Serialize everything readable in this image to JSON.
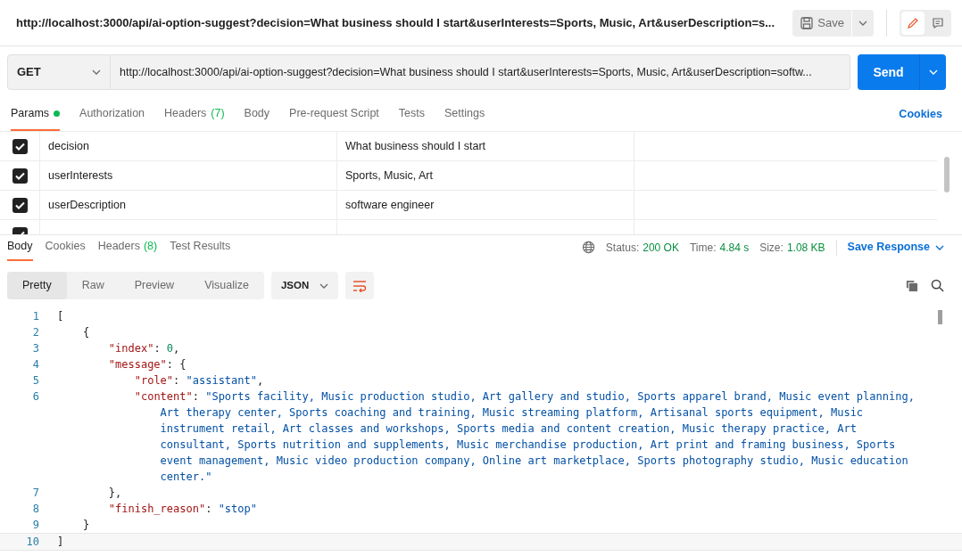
{
  "header": {
    "title": "http://localhost:3000/api/ai-option-suggest?decision=What business should I start&userInterests=Sports, Music, Art&userDescription=s...",
    "save_label": "Save",
    "modes": [
      {
        "kind": "edit",
        "selected": true
      },
      {
        "kind": "comment",
        "selected": false
      }
    ]
  },
  "request": {
    "method": "GET",
    "url": "http://localhost:3000/api/ai-option-suggest?decision=What business should I start&userInterests=Sports, Music, Art&userDescription=softw...",
    "send_label": "Send"
  },
  "request_tabs": [
    {
      "label": "Params",
      "dot": true,
      "selected": true
    },
    {
      "label": "Authorization",
      "dot": false,
      "selected": false
    },
    {
      "label": "Headers",
      "count": "(7)",
      "dot": false,
      "selected": false
    },
    {
      "label": "Body",
      "dot": false,
      "selected": false
    },
    {
      "label": "Pre-request Script",
      "dot": false,
      "selected": false
    },
    {
      "label": "Tests",
      "dot": false,
      "selected": false
    },
    {
      "label": "Settings",
      "dot": false,
      "selected": false
    }
  ],
  "cookies_link": "Cookies",
  "params": [
    {
      "checked": true,
      "key": "decision",
      "value": "What business should I start"
    },
    {
      "checked": true,
      "key": "userInterests",
      "value": "Sports, Music, Art"
    },
    {
      "checked": true,
      "key": "userDescription",
      "value": "software engineer"
    },
    {
      "checked": true
    }
  ],
  "response_tabs": [
    {
      "label": "Body",
      "selected": true
    },
    {
      "label": "Cookies",
      "selected": false
    },
    {
      "label": "Headers",
      "count": "(8)",
      "selected": false
    },
    {
      "label": "Test Results",
      "selected": false
    }
  ],
  "response_stats": [
    {
      "label": "Status:",
      "value": "200 OK"
    },
    {
      "label": "Time:",
      "value": "4.84 s"
    },
    {
      "label": "Size:",
      "value": "1.08 KB"
    }
  ],
  "save_response": "Save Response",
  "view_modes": [
    {
      "label": "Pretty",
      "selected": true
    },
    {
      "label": "Raw",
      "selected": false
    },
    {
      "label": "Preview",
      "selected": false
    },
    {
      "label": "Visualize",
      "selected": false
    }
  ],
  "format": "JSON",
  "code_lines": [
    {
      "number": "1",
      "tokens": [
        {
          "kind": "punct",
          "text": "["
        }
      ]
    },
    {
      "number": "2",
      "tokens": [
        {
          "kind": "punct",
          "text": "    {"
        }
      ]
    },
    {
      "number": "3",
      "tokens": [
        {
          "kind": "key",
          "text": "        \"index\""
        },
        {
          "kind": "punct",
          "text": ": "
        },
        {
          "kind": "number",
          "text": "0"
        },
        {
          "kind": "punct",
          "text": ","
        }
      ]
    },
    {
      "number": "4",
      "tokens": [
        {
          "kind": "key",
          "text": "        \"message\""
        },
        {
          "kind": "punct",
          "text": ": {"
        }
      ]
    },
    {
      "number": "5",
      "tokens": [
        {
          "kind": "key",
          "text": "            \"role\""
        },
        {
          "kind": "punct",
          "text": ": "
        },
        {
          "kind": "string",
          "text": "\"assistant\""
        },
        {
          "kind": "punct",
          "text": ","
        }
      ]
    },
    {
      "number": "6",
      "tokens": [
        {
          "kind": "key",
          "text": "            \"content\""
        },
        {
          "kind": "punct",
          "text": ": "
        },
        {
          "kind": "string",
          "text": "\"Sports facility, Music production studio, Art gallery and studio, Sports apparel brand, Music event planning, Art therapy center, Sports coaching and training, Music streaming platform, Artisanal sports equipment, Music instrument retail, Art classes and workshops, Sports media and content creation, Music therapy practice, Art consultant, Sports nutrition and supplements, Music merchandise production, Art print and framing business, Sports event management, Music video production company, Online art marketplace, Sports photography studio, Music education center.\""
        }
      ]
    },
    {
      "number": "7",
      "tokens": [
        {
          "kind": "punct",
          "text": "        },"
        }
      ]
    },
    {
      "number": "8",
      "tokens": [
        {
          "kind": "key",
          "text": "        \"finish_reason\""
        },
        {
          "kind": "punct",
          "text": ": "
        },
        {
          "kind": "string",
          "text": "\"stop\""
        }
      ]
    },
    {
      "number": "9",
      "tokens": [
        {
          "kind": "punct",
          "text": "    }"
        }
      ]
    },
    {
      "number": "10",
      "tokens": [
        {
          "kind": "punct",
          "text": "]"
        }
      ]
    }
  ]
}
